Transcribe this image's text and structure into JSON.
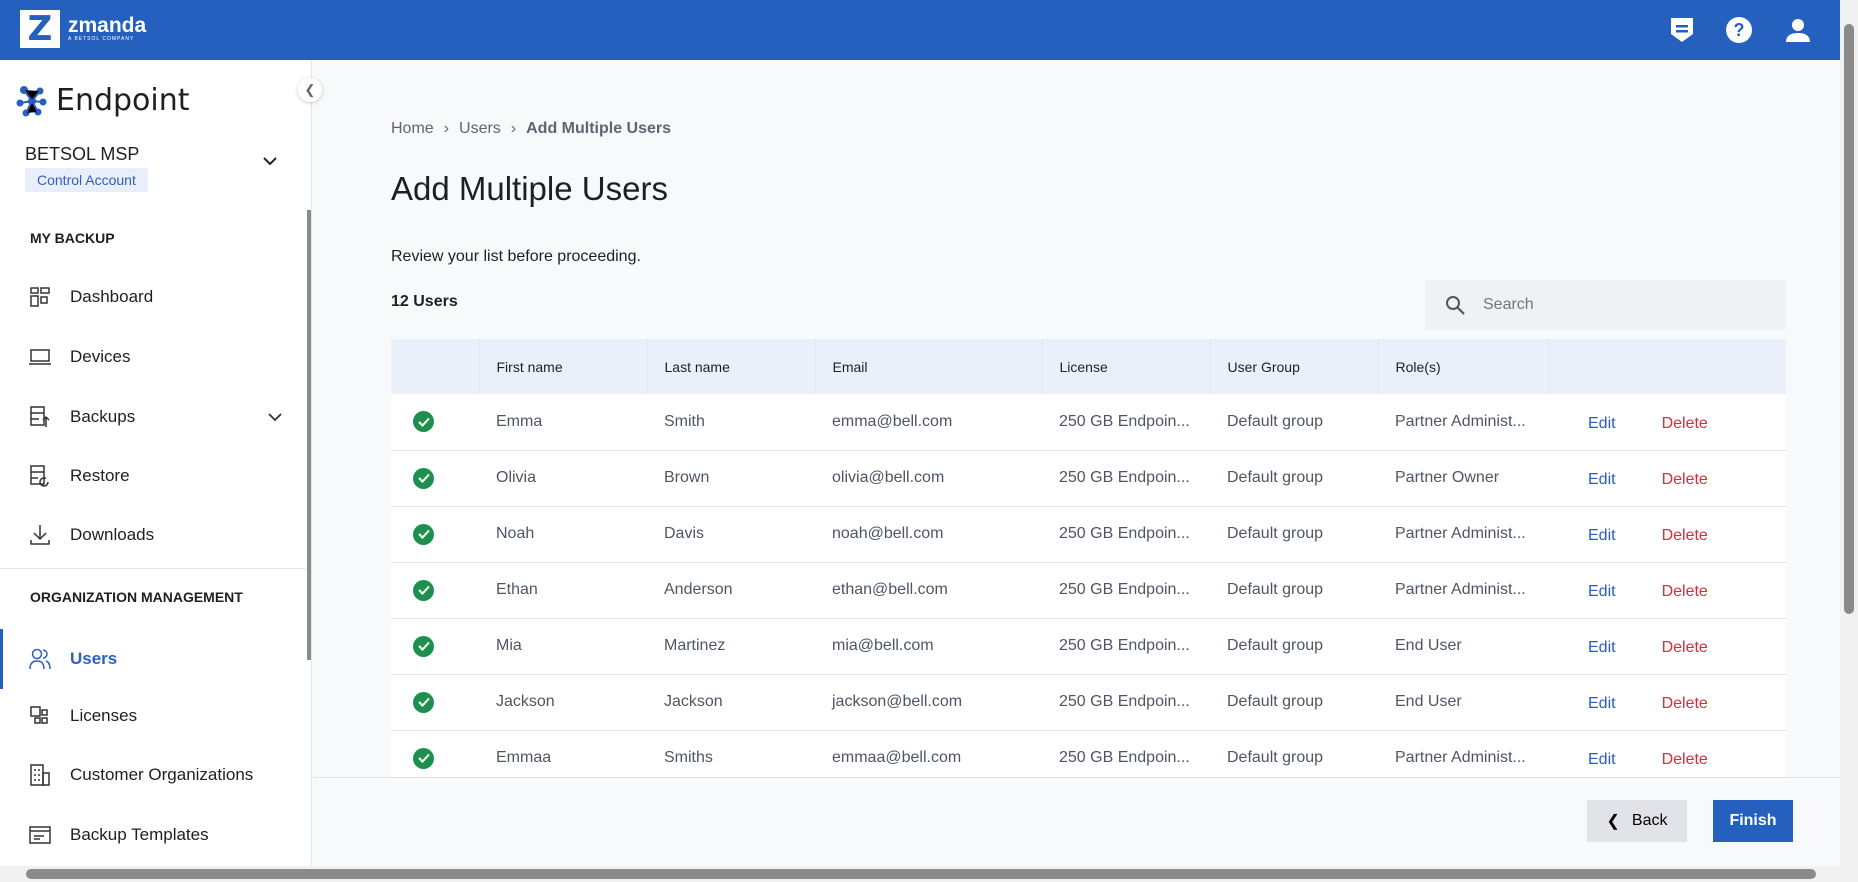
{
  "header": {
    "logo_name": "zmanda",
    "logo_sub": "A BETSOL COMPANY",
    "icons": [
      "notes-icon",
      "help-icon",
      "user-icon"
    ]
  },
  "sidebar": {
    "product": "Endpoint",
    "org_name": "BETSOL MSP",
    "org_badge": "Control Account",
    "sections": [
      {
        "title": "MY BACKUP",
        "items": [
          {
            "label": "Dashboard"
          },
          {
            "label": "Devices"
          },
          {
            "label": "Backups"
          },
          {
            "label": "Restore"
          },
          {
            "label": "Downloads"
          }
        ]
      },
      {
        "title": "ORGANIZATION MANAGEMENT",
        "items": [
          {
            "label": "Users"
          },
          {
            "label": "Licenses"
          },
          {
            "label": "Customer Organizations"
          },
          {
            "label": "Backup Templates"
          }
        ]
      }
    ]
  },
  "breadcrumb": [
    "Home",
    "Users",
    "Add Multiple Users"
  ],
  "page": {
    "title": "Add Multiple Users",
    "subtitle": "Review your list before proceeding.",
    "count": "12 Users",
    "search_placeholder": "Search"
  },
  "table": {
    "columns": [
      "",
      "First name",
      "Last name",
      "Email",
      "License",
      "User Group",
      "Role(s)",
      ""
    ],
    "edit_label": "Edit",
    "delete_label": "Delete",
    "rows": [
      {
        "first": "Emma",
        "last": "Smith",
        "email": "emma@bell.com",
        "license": "250 GB Endpoin...",
        "group": "Default group",
        "role": "Partner Administ..."
      },
      {
        "first": "Olivia",
        "last": "Brown",
        "email": "olivia@bell.com",
        "license": "250 GB Endpoin...",
        "group": "Default group",
        "role": "Partner Owner"
      },
      {
        "first": "Noah",
        "last": "Davis",
        "email": "noah@bell.com",
        "license": "250 GB Endpoin...",
        "group": "Default group",
        "role": "Partner Administ..."
      },
      {
        "first": "Ethan",
        "last": "Anderson",
        "email": "ethan@bell.com",
        "license": "250 GB Endpoin...",
        "group": "Default group",
        "role": "Partner Administ..."
      },
      {
        "first": "Mia",
        "last": "Martinez",
        "email": "mia@bell.com",
        "license": "250 GB Endpoin...",
        "group": "Default group",
        "role": "End User"
      },
      {
        "first": "Jackson",
        "last": "Jackson",
        "email": "jackson@bell.com",
        "license": "250 GB Endpoin...",
        "group": "Default group",
        "role": "End User"
      },
      {
        "first": "Emmaa",
        "last": "Smiths",
        "email": "emmaa@bell.com",
        "license": "250 GB Endpoin...",
        "group": "Default group",
        "role": "Partner Administ..."
      }
    ]
  },
  "footer": {
    "back_label": "Back",
    "finish_label": "Finish"
  },
  "colors": {
    "primary": "#2560bf",
    "success": "#1f8f4e",
    "danger": "#d32f3a"
  }
}
